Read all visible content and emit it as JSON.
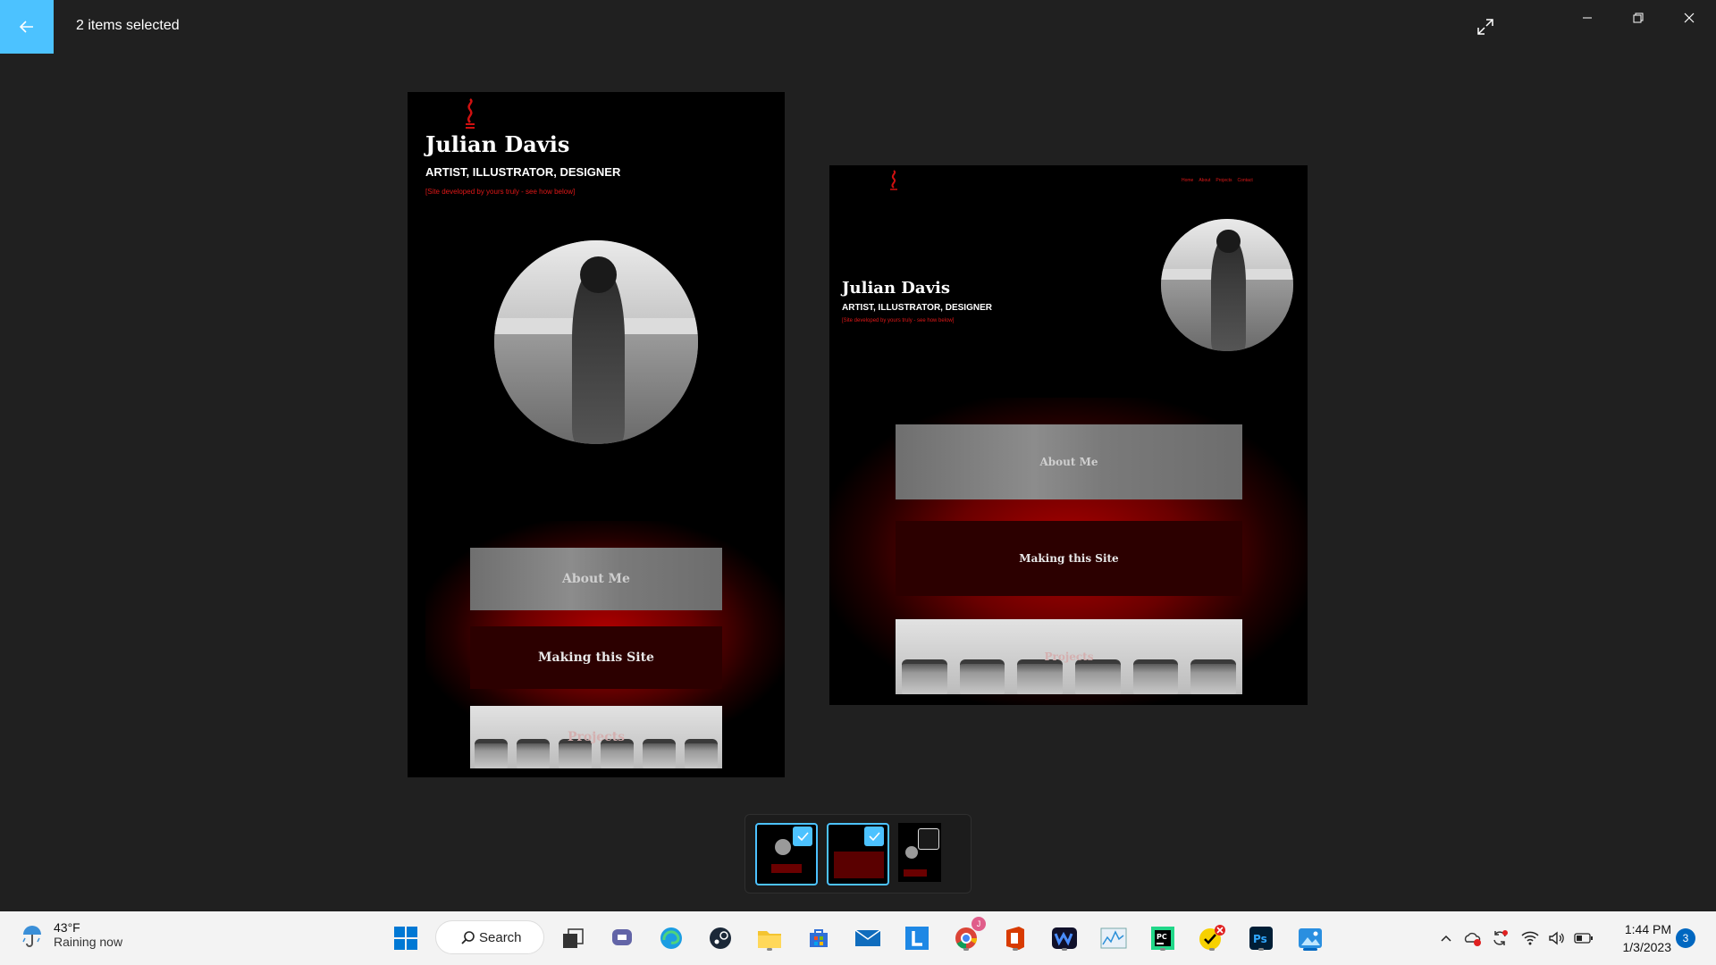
{
  "titlebar": {
    "selection_text": "2 items selected",
    "back_icon": "arrow-left-icon",
    "accent": "#4cc2ff"
  },
  "images": {
    "mobile": {
      "name": "Julian Davis",
      "role": "ARTIST, ILLUSTRATOR, DESIGNER",
      "note": "[Site developed by yours truly - see how below]",
      "panels": [
        "About Me",
        "Making this Site",
        "Projects"
      ]
    },
    "desktop": {
      "name": "Julian Davis",
      "role": "ARTIST, ILLUSTRATOR, DESIGNER",
      "note": "[Site developed by yours truly - see how below]",
      "nav": [
        "Home",
        "About",
        "Projects",
        "Contact"
      ],
      "panels": [
        "About Me",
        "Making this Site",
        "Projects"
      ]
    }
  },
  "filmstrip": {
    "thumbs": [
      {
        "label": "mobile screenshot",
        "selected": true
      },
      {
        "label": "desktop screenshot",
        "selected": true
      },
      {
        "label": "mobile screenshot 2",
        "selected": false
      }
    ]
  },
  "taskbar": {
    "weather_temp": "43°F",
    "weather_condition": "Raining now",
    "search_label": "Search",
    "chrome_badge": "J",
    "time": "1:44 PM",
    "date": "1/3/2023",
    "notification_count": "3"
  }
}
